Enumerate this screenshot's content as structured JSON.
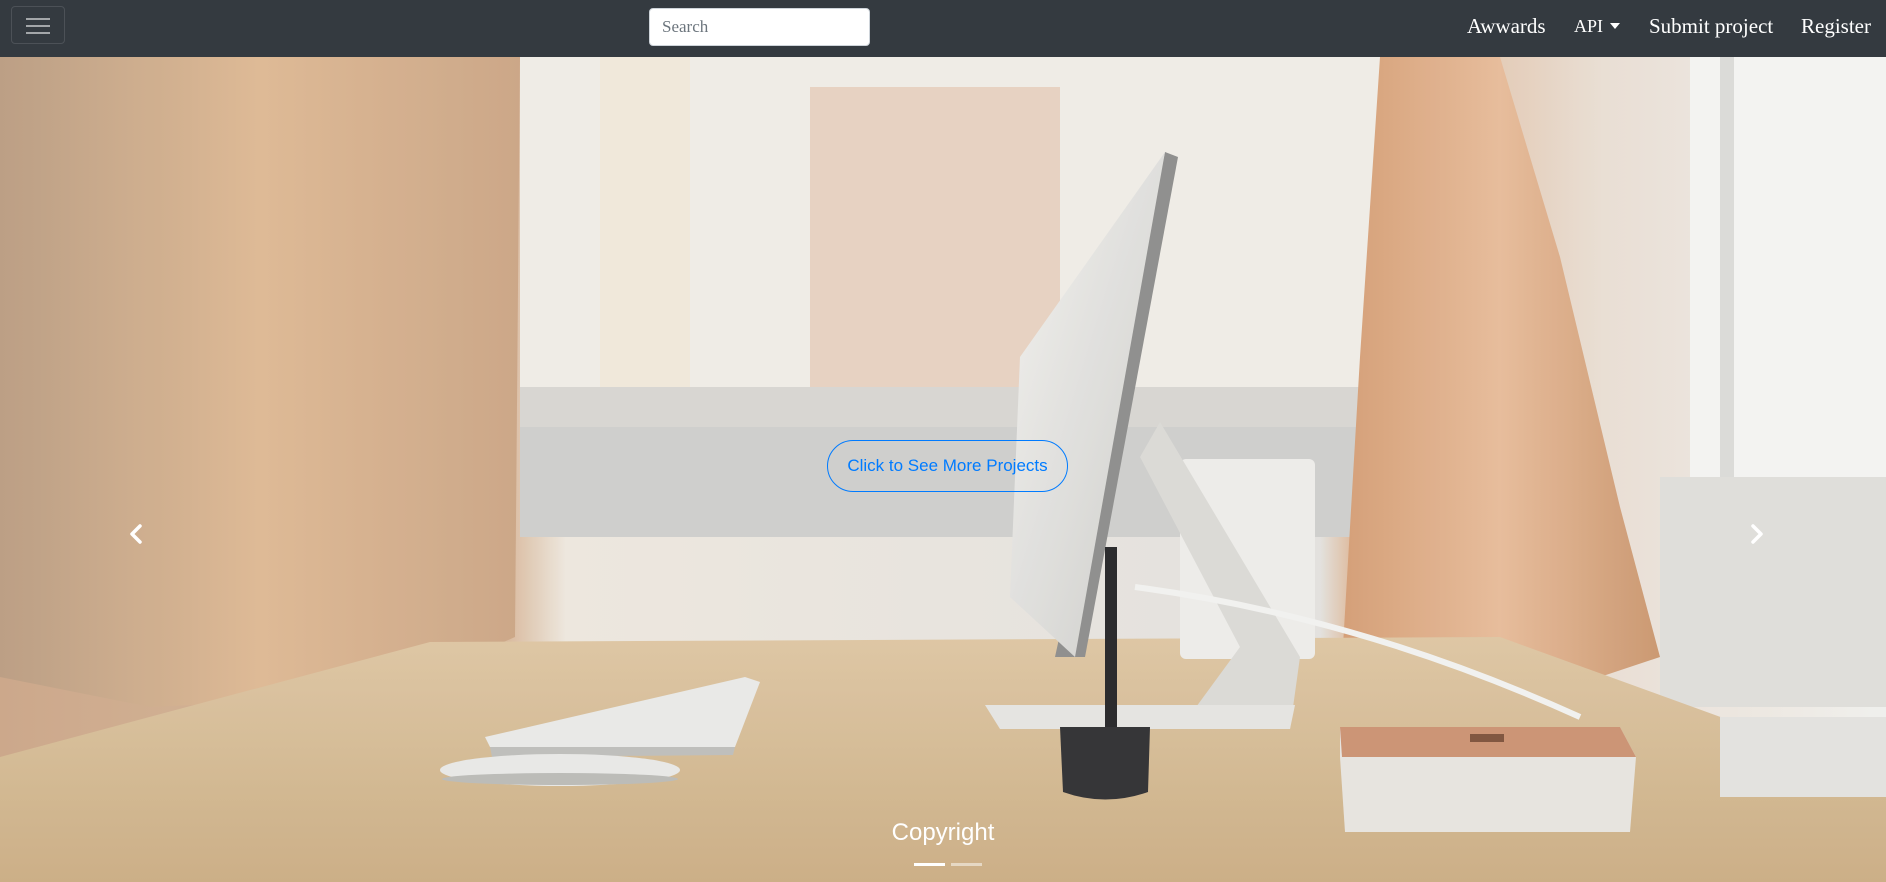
{
  "navbar": {
    "search": {
      "placeholder": "Search",
      "value": ""
    },
    "links": {
      "awwards": "Awwards",
      "api": "API",
      "submit": "Submit project",
      "register": "Register"
    }
  },
  "hero": {
    "cta_label": "Click to See More Projects",
    "footer_text": "Copyright",
    "active_slide": 1,
    "slide_count": 2
  },
  "colors": {
    "navbar_bg": "#343a40",
    "cta_blue": "#007bff",
    "text_white": "#ffffff"
  },
  "icons": [
    "menu-icon",
    "caret-down-icon",
    "chevron-left-icon",
    "chevron-right-icon"
  ]
}
